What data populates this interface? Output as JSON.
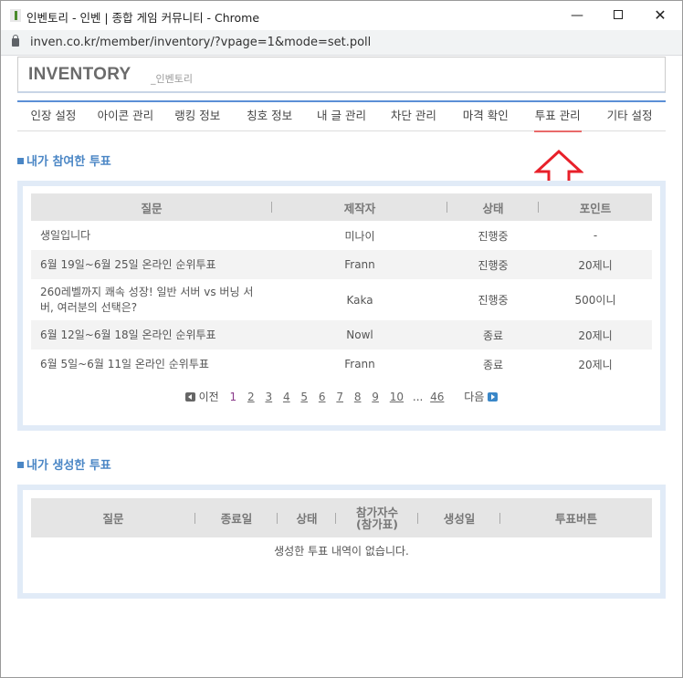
{
  "window": {
    "title": "인벤토리 - 인벤 | 종합 게임 커뮤니티 - Chrome",
    "url": "inven.co.kr/member/inventory/?vpage=1&mode=set.poll"
  },
  "header": {
    "logo": "INVENTORY",
    "logo_sub": "_인벤토리"
  },
  "nav": {
    "tabs": [
      {
        "label": "인장 설정"
      },
      {
        "label": "아이콘 관리"
      },
      {
        "label": "랭킹 정보"
      },
      {
        "label": "칭호 정보"
      },
      {
        "label": "내 글 관리"
      },
      {
        "label": "차단 관리"
      },
      {
        "label": "마격 확인"
      },
      {
        "label": "투표 관리"
      },
      {
        "label": "기타 설정"
      }
    ],
    "active_tab": "투표 관리"
  },
  "participated": {
    "title": "내가 참여한 투표",
    "columns": [
      "질문",
      "제작자",
      "상태",
      "포인트"
    ],
    "rows": [
      {
        "question": "생일입니다",
        "author": "미나이",
        "status": "진행중",
        "points": "-"
      },
      {
        "question": "6월 19일~6월 25일 온라인 순위투표",
        "author": "Frann",
        "status": "진행중",
        "points": "20제니"
      },
      {
        "question": "260레벨까지 쾌속 성장! 일반 서버 vs 버닝 서버, 여러분의 선택은?",
        "author": "Kaka",
        "status": "진행중",
        "points": "500이니"
      },
      {
        "question": "6월 12일~6월 18일 온라인 순위투표",
        "author": "Nowl",
        "status": "종료",
        "points": "20제니"
      },
      {
        "question": "6월 5일~6월 11일 온라인 순위투표",
        "author": "Frann",
        "status": "종료",
        "points": "20제니"
      }
    ],
    "pagination": {
      "prev_label": "이전",
      "next_label": "다음",
      "pages": [
        "1",
        "2",
        "3",
        "4",
        "5",
        "6",
        "7",
        "8",
        "9",
        "10"
      ],
      "ellipsis": "...",
      "last": "46",
      "current": "1"
    }
  },
  "created": {
    "title": "내가 생성한 투표",
    "columns": [
      "질문",
      "종료일",
      "상태",
      "참가자수\n(참가표)",
      "생성일",
      "투표버튼"
    ],
    "empty_message": "생성한 투표 내역이 없습니다."
  },
  "annotation": {
    "color": "#e8202a"
  }
}
